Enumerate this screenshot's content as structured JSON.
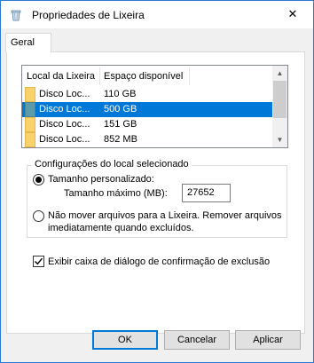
{
  "window": {
    "title": "Propriedades de Lixeira",
    "close_glyph": "✕"
  },
  "tabs": [
    {
      "label": "Geral"
    }
  ],
  "list": {
    "columns": [
      "Local da Lixeira",
      "Espaço disponível"
    ],
    "rows": [
      {
        "location": "Disco Loc...",
        "space": "110 GB",
        "selected": false
      },
      {
        "location": "Disco Loc...",
        "space": "500 GB",
        "selected": true
      },
      {
        "location": "Disco Loc...",
        "space": "151 GB",
        "selected": false
      },
      {
        "location": "Disco Loc...",
        "space": "852 MB",
        "selected": false
      }
    ],
    "scroll_up": "▲",
    "scroll_down": "▼"
  },
  "settings": {
    "group_title": "Configurações do local selecionado",
    "custom_size_label": "Tamanho personalizado:",
    "max_size_label": "Tamanho máximo (MB):",
    "max_size_value": "27652",
    "no_move_label_line1": "Não mover arquivos para a Lixeira. Remover arquivos",
    "no_move_label_line2": "imediatamente quando excluídos.",
    "selected_option": "custom_size"
  },
  "confirm": {
    "label": "Exibir caixa de diálogo de confirmação de exclusão",
    "checked": true
  },
  "buttons": {
    "ok": "OK",
    "cancel": "Cancelar",
    "apply": "Aplicar"
  },
  "colors": {
    "accent": "#0078d7",
    "folder": "#f9d26e",
    "selected_folder": "#5b9baa"
  }
}
